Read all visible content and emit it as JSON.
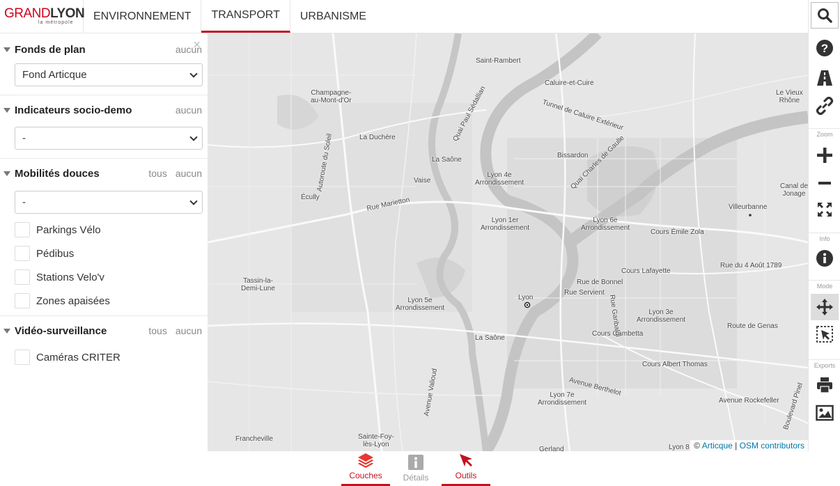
{
  "logo": {
    "part1": "GRAND",
    "part2": "LYON",
    "sub": "la métropole"
  },
  "tabs": [
    {
      "label": "ENVIRONNEMENT",
      "active": false
    },
    {
      "label": "TRANSPORT",
      "active": true
    },
    {
      "label": "URBANISME",
      "active": false
    }
  ],
  "panel": {
    "close": "×",
    "sections": [
      {
        "title": "Fonds de plan",
        "actions": [
          "aucun"
        ],
        "select_value": "Fond Articque",
        "checks": []
      },
      {
        "title": "Indicateurs socio-demo",
        "actions": [
          "aucun"
        ],
        "select_value": "-",
        "checks": []
      },
      {
        "title": "Mobilités douces",
        "actions": [
          "tous",
          "aucun"
        ],
        "select_value": "-",
        "checks": [
          "Parkings Vélo",
          "Pédibus",
          "Stations Velo'v",
          "Zones apaisées"
        ]
      },
      {
        "title": "Vidéo-surveillance",
        "actions": [
          "tous",
          "aucun"
        ],
        "select_value": null,
        "checks": [
          "Caméras CRITER"
        ]
      }
    ]
  },
  "map": {
    "labels": [
      "Saint-Rambert",
      "Caluire-et-Cuire",
      "Le Vieux\nRhône",
      "Champagne-\nau-Mont-d'Or",
      "La Duchère",
      "La Saône",
      "Bissardon",
      "Vaise",
      "Lyon 4e\nArrondissement",
      "Canal de\nJonage",
      "Écully",
      "Villeurbanne",
      "Lyon 1er\nArrondissement",
      "Lyon 6e\nArrondissement",
      "Cours Émile Zola",
      "Cours Lafayette",
      "Rue du 4 Août 1789",
      "Tassin-la-\nDemi-Lune",
      "Rue de Bonnel",
      "Rue Servient",
      "Lyon 5e\nArrondissement",
      "Lyon",
      "Lyon 3e\nArrondissement",
      "Route de Genas",
      "La Saône",
      "Cours Gambetta",
      "Cours Albert Thomas",
      "Lyon 7e\nArrondissement",
      "Avenue Rockefeller",
      "Francheville",
      "Sainte-Foy-\nlès-Lyon",
      "Gerland",
      "Lyon 8",
      "Rue Marietton",
      "Quai Paul Sédallian",
      "Tunnel de Caluire Extérieur",
      "Quai Charles de Gaulle",
      "Autoroute du Soleil",
      "Avenue Berthelot",
      "Boulevard Pinel",
      "Rue Garibaldi",
      "Avenue Valioud"
    ],
    "attribution": {
      "prefix": "© ",
      "link1": "Articque",
      "sep": " | ",
      "link2": "OSM contributors"
    }
  },
  "toolbar": {
    "sections": {
      "zoom": "Zoom",
      "info": "Info",
      "mode": "Mode",
      "exports": "Exports"
    },
    "icons": [
      "search-icon",
      "help-icon",
      "road-icon",
      "link-icon",
      "zoom-in-icon",
      "zoom-out-icon",
      "fullscreen-icon",
      "info-icon",
      "pan-icon",
      "select-icon",
      "print-icon",
      "image-icon"
    ]
  },
  "bottom": {
    "buttons": [
      {
        "label": "Couches",
        "state": "on"
      },
      {
        "label": "Détails",
        "state": "off"
      },
      {
        "label": "Outils",
        "state": "on"
      }
    ]
  },
  "colors": {
    "accent": "#c1121f",
    "map_bg": "#e8e8e8",
    "water": "#c9c9c9"
  }
}
